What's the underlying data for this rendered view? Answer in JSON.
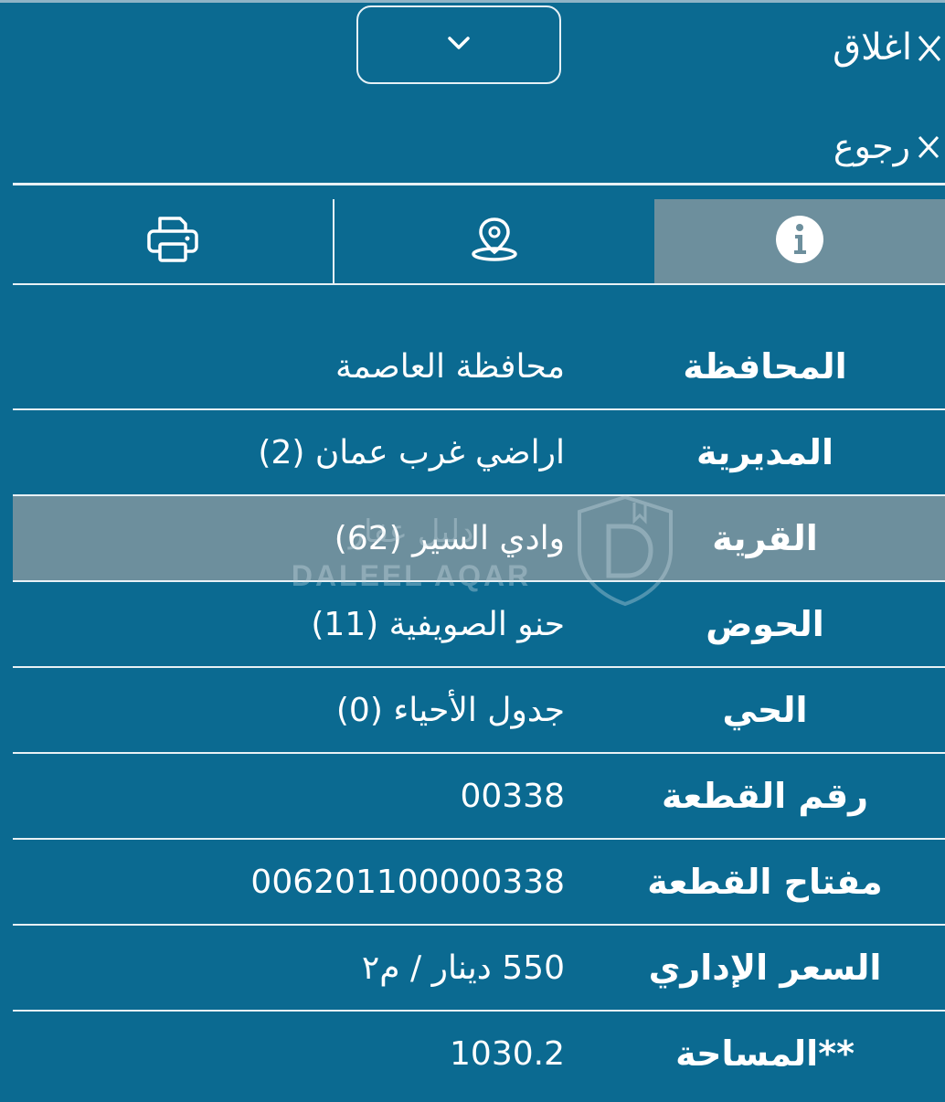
{
  "header": {
    "close_label": "اغلاق",
    "back_label": "رجوع",
    "dropdown_icon": "chevron-down-icon"
  },
  "tabs": [
    {
      "name": "info",
      "icon": "info-icon",
      "active": true
    },
    {
      "name": "location",
      "icon": "location-pin-icon",
      "active": false
    },
    {
      "name": "print",
      "icon": "printer-icon",
      "active": false
    }
  ],
  "table": {
    "rows": [
      {
        "label": "المحافظة",
        "value": "محافظة العاصمة",
        "highlight": false
      },
      {
        "label": "المديرية",
        "value": "اراضي غرب عمان (2)",
        "highlight": false
      },
      {
        "label": "القرية",
        "value": "وادي السير (62)",
        "highlight": true
      },
      {
        "label": "الحوض",
        "value": "حنو الصويفية (11)",
        "highlight": false
      },
      {
        "label": "الحي",
        "value": "جدول الأحياء (0)",
        "highlight": false
      },
      {
        "label": "رقم القطعة",
        "value": "00338",
        "highlight": false
      },
      {
        "label": "مفتاح القطعة",
        "value": "006201100000338",
        "highlight": false
      },
      {
        "label": "السعر الإداري",
        "value": "550 دينار / م٢",
        "highlight": false
      },
      {
        "label": "**المساحة",
        "value": "1030.2",
        "highlight": false
      }
    ]
  },
  "watermark": {
    "text_ar": "دليل عقار",
    "text_en": "DALEEL AQAR"
  },
  "colors": {
    "background": "#0b6a91",
    "active_tab": "#6d8f9d",
    "highlight_row": "#6d8f9d",
    "divider": "#e8f1f5",
    "text": "#ffffff"
  }
}
